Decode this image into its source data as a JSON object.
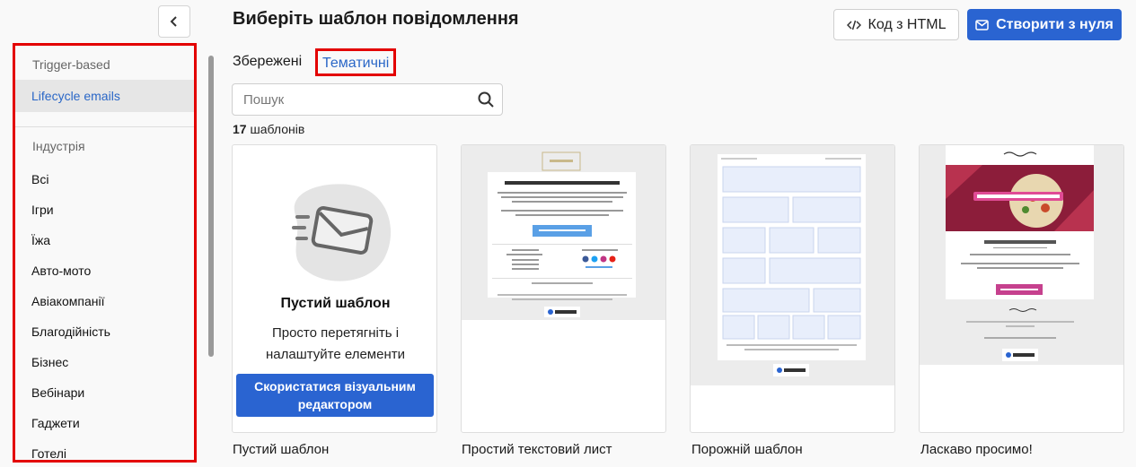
{
  "sidebar": {
    "collapse_icon": "chevron-left-icon",
    "section_trigger": "Trigger-based",
    "lifecycle": "Lifecycle emails",
    "section_industry": "Індустрія",
    "industries": [
      "Всі",
      "Ігри",
      "Їжа",
      "Авто-мото",
      "Авіакомпанії",
      "Благодійність",
      "Бізнес",
      "Вебінари",
      "Гаджети",
      "Готелі"
    ]
  },
  "header": {
    "title": "Виберіть шаблон повідомлення",
    "html_button": "Код з HTML",
    "create_button": "Створити з нуля"
  },
  "tabs": {
    "saved": "Збережені",
    "themed": "Тематичні"
  },
  "search": {
    "placeholder": "Пошук"
  },
  "count": {
    "number": "17",
    "label": "шаблонів"
  },
  "blank_card": {
    "title": "Пустий шаблон",
    "description": "Просто перетягніть і налаштуйте елементи",
    "button": "Скористатися візуальним редактором"
  },
  "templates": [
    {
      "label": "Пустий шаблон"
    },
    {
      "label": "Простий текстовий лист"
    },
    {
      "label": "Порожній шаблон"
    },
    {
      "label": "Ласкаво просимо!"
    }
  ],
  "colors": {
    "accent": "#2a64d1",
    "highlight_border": "#e30000",
    "link": "#2a67c7"
  }
}
